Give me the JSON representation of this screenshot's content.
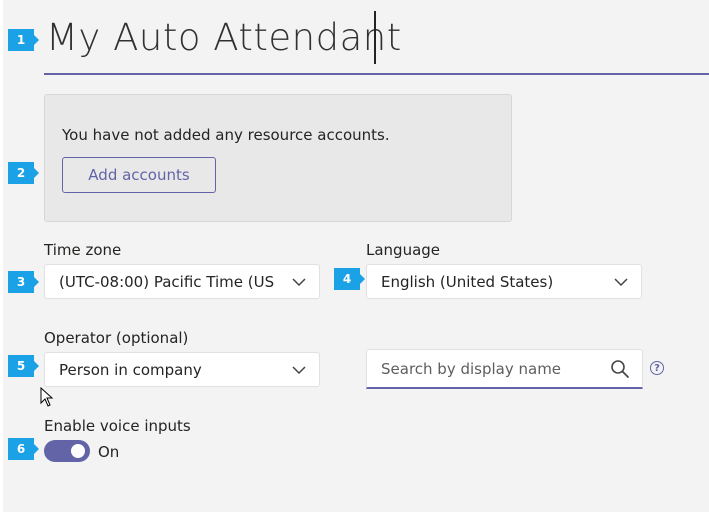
{
  "title": "My Auto Attendant",
  "resource_accounts": {
    "message": "You have not added any resource accounts.",
    "add_button": "Add accounts"
  },
  "time_zone": {
    "label": "Time zone",
    "value": "(UTC-08:00) Pacific Time (US ..."
  },
  "language": {
    "label": "Language",
    "value": "English (United States)"
  },
  "operator": {
    "label": "Operator (optional)",
    "value": "Person in company",
    "search_placeholder": "Search by display name",
    "help_glyph": "?"
  },
  "voice_inputs": {
    "label": "Enable voice inputs",
    "state": "On",
    "enabled": true
  },
  "markers": [
    "1",
    "2",
    "3",
    "4",
    "5",
    "6"
  ],
  "colors": {
    "accent": "#6264a7",
    "marker": "#1aa1e6",
    "background": "#f3f3f3"
  },
  "icons": [
    "chevron-down-icon",
    "search-icon",
    "help-icon",
    "mouse-pointer-icon"
  ]
}
